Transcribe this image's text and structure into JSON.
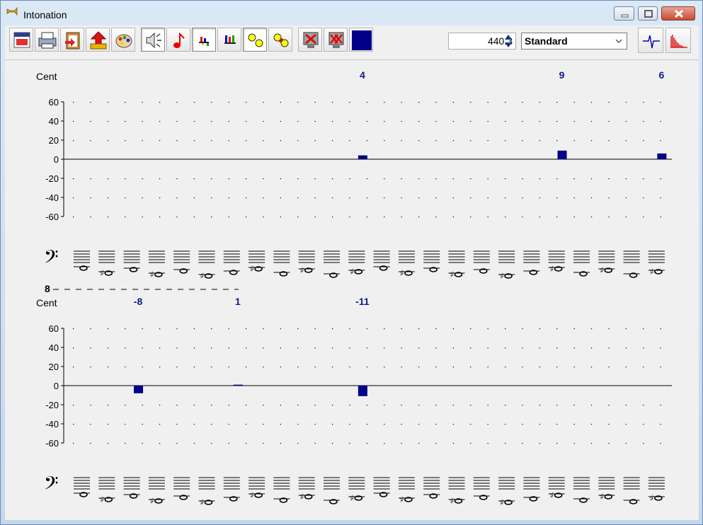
{
  "window": {
    "title": "Intonation"
  },
  "toolbar": {
    "buttons": [
      {
        "name": "window-view-button",
        "icon": "window-icon",
        "pressed": false
      },
      {
        "name": "print-button",
        "icon": "printer-icon",
        "pressed": false
      },
      {
        "name": "clipboard-button",
        "icon": "clipboard-icon",
        "pressed": false
      },
      {
        "name": "export-button",
        "icon": "export-arrow-icon",
        "pressed": false
      },
      {
        "name": "colors-button",
        "icon": "palette-icon",
        "pressed": false
      },
      {
        "name": "sound-button",
        "icon": "speaker-icon",
        "pressed": true
      },
      {
        "name": "note-button",
        "icon": "eighth-note-icon",
        "pressed": false
      },
      {
        "name": "bars-view-button",
        "icon": "bars-icon",
        "pressed": true
      },
      {
        "name": "comb-view-button",
        "icon": "comb-icon",
        "pressed": false
      },
      {
        "name": "circles-button",
        "icon": "yellow-circles-icon",
        "pressed": true
      },
      {
        "name": "linked-circles-button",
        "icon": "linked-circles-icon",
        "pressed": false
      },
      {
        "name": "delete-button",
        "icon": "delete-monitor-icon",
        "pressed": false
      },
      {
        "name": "delete-all-button",
        "icon": "delete-all-icon",
        "pressed": false
      },
      {
        "name": "color-swatch-button",
        "icon": "color-square-icon",
        "pressed": false
      }
    ],
    "pitch_value": "440.3",
    "tuning_selected": "Standard",
    "right_buttons": [
      {
        "name": "waveform-button",
        "icon": "waveform-icon"
      },
      {
        "name": "spectrum-button",
        "icon": "spectrum-icon"
      }
    ]
  },
  "colors": {
    "bar": "#00008b",
    "value_text": "#0d1b8a",
    "accent": "#0000b0"
  },
  "charts": [
    {
      "ylabel": "Cent",
      "yticks": [
        "60",
        "40",
        "20",
        "0",
        "-20",
        "-40",
        "-60"
      ],
      "ylim": [
        -60,
        60
      ],
      "slots": 24,
      "values": [
        null,
        null,
        null,
        null,
        null,
        null,
        null,
        null,
        null,
        null,
        null,
        4,
        null,
        null,
        null,
        null,
        null,
        null,
        null,
        9,
        null,
        null,
        null,
        6
      ],
      "value_labels": [
        "4",
        "9",
        "6"
      ],
      "clef": "bass",
      "octave_mark": "8"
    },
    {
      "ylabel": "Cent",
      "yticks": [
        "60",
        "40",
        "20",
        "0",
        "-20",
        "-40",
        "-60"
      ],
      "ylim": [
        -60,
        60
      ],
      "slots": 24,
      "values": [
        null,
        null,
        -8,
        null,
        null,
        null,
        1,
        null,
        null,
        null,
        null,
        -11,
        null,
        null,
        null,
        null,
        null,
        null,
        null,
        null,
        null,
        null,
        null,
        null
      ],
      "value_labels": [
        "-8",
        "1",
        "-11"
      ],
      "clef": "bass"
    }
  ]
}
